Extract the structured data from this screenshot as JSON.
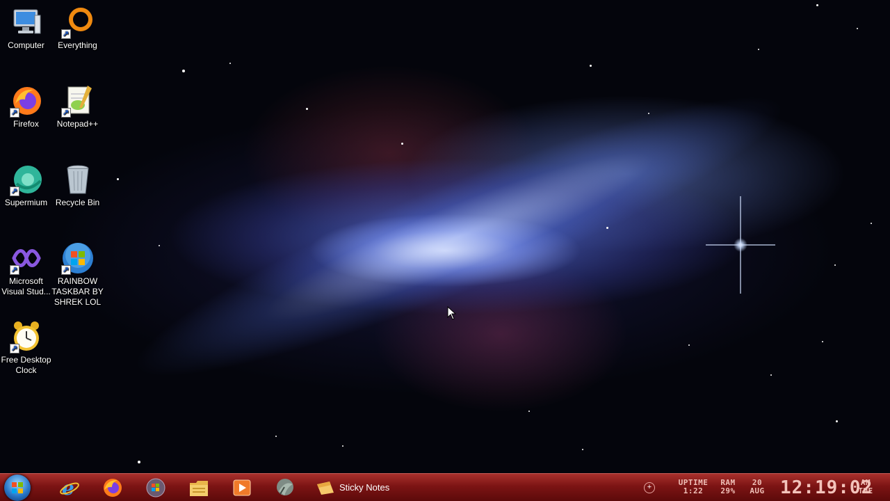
{
  "desktop": {
    "icons": [
      {
        "label": "Computer"
      },
      {
        "label": "Everything"
      },
      {
        "label": "Firefox"
      },
      {
        "label": "Notepad++"
      },
      {
        "label": "Supermium"
      },
      {
        "label": "Recycle Bin"
      },
      {
        "label": "Microsoft Visual Stud..."
      },
      {
        "label": "RAINBOW TASKBAR BY SHREK LOL"
      },
      {
        "label": "Free Desktop Clock"
      }
    ]
  },
  "taskbar": {
    "start_icon": "windows-start-orb",
    "pinned": [
      {
        "icon": "internet-explorer-icon"
      },
      {
        "icon": "firefox-icon"
      },
      {
        "icon": "windows-media-icon"
      },
      {
        "icon": "file-explorer-icon"
      },
      {
        "icon": "media-player-icon"
      },
      {
        "icon": "snipping-tool-icon"
      }
    ],
    "sticky_notes_label": "Sticky Notes",
    "tray_plus": "+"
  },
  "tray": {
    "uptime_label": "UPTIME",
    "uptime_value": "1:22",
    "ram_label": "RAM",
    "ram_value": "29%",
    "date_day": "20",
    "date_month": "AUG",
    "time": "12:19:02",
    "ampm": "AM",
    "weekday": "TUE"
  },
  "colors": {
    "taskbar": "#7c1414",
    "tray_text": "#f0c0b8"
  }
}
